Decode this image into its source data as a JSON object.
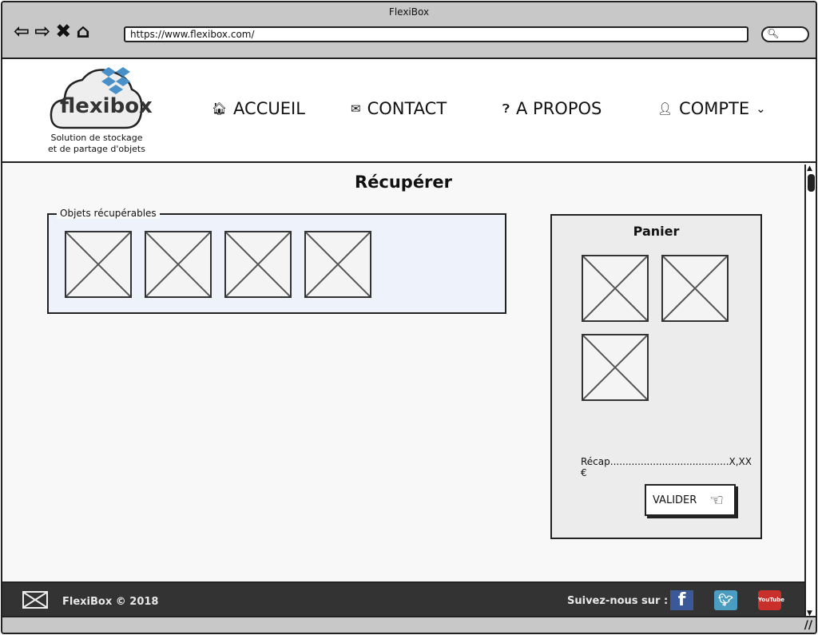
{
  "window": {
    "title": "FlexiBox",
    "url": "https://www.flexibox.com/"
  },
  "header": {
    "logo_text": "flexibox",
    "tagline_1": "Solution de stockage",
    "tagline_2": "et de partage d'objets",
    "nav": [
      {
        "label": "ACCUEIL",
        "icon": "home-icon"
      },
      {
        "label": "CONTACT",
        "icon": "envelope-icon"
      },
      {
        "label": "A PROPOS",
        "icon": "question-icon"
      },
      {
        "label": "COMPTE",
        "icon": "user-icon"
      }
    ]
  },
  "main": {
    "title": "Récupérer",
    "group_label": "Objets récupérables",
    "objects_count": 4
  },
  "cart": {
    "title": "Panier",
    "items_count": 3,
    "recap_label": "Récap",
    "recap_value": "X,XX €",
    "validate_label": "VALIDER"
  },
  "footer": {
    "copyright": "FlexiBox © 2018",
    "follow": "Suivez-nous sur :",
    "youtube": "YouTube"
  },
  "colors": {
    "brand": "#4a90c8",
    "footer_bg": "#333333",
    "facebook": "#3b5998",
    "twitter": "#4a9cc0",
    "youtube": "#c9302c"
  }
}
